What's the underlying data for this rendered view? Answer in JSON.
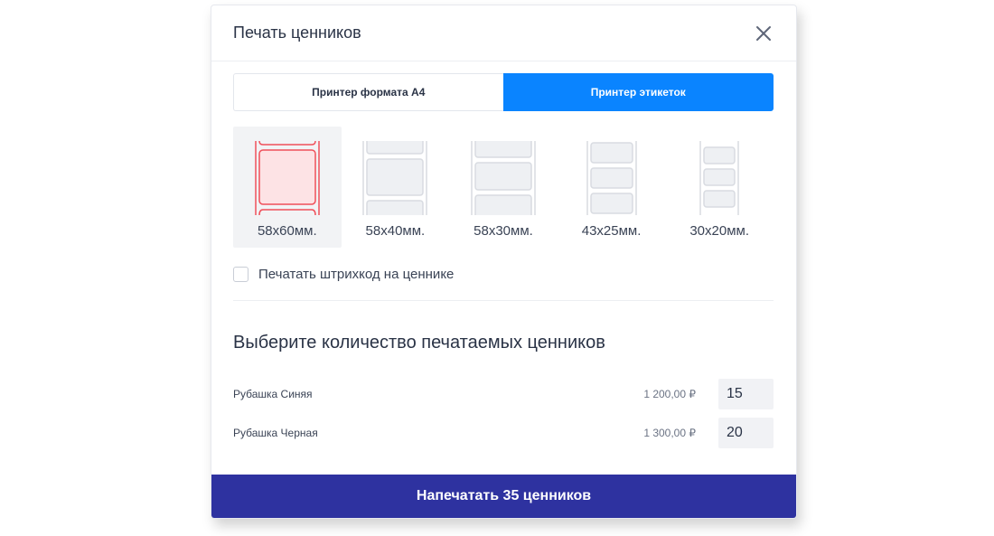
{
  "dialog": {
    "title": "Печать ценников",
    "close_icon": "close-icon"
  },
  "tabs": [
    {
      "label": "Принтер формата А4",
      "active": false
    },
    {
      "label": "Принтер этикеток",
      "active": true
    }
  ],
  "label_sizes": [
    {
      "label": "58x60мм.",
      "selected": true
    },
    {
      "label": "58x40мм.",
      "selected": false
    },
    {
      "label": "58x30мм.",
      "selected": false
    },
    {
      "label": "43x25мм.",
      "selected": false
    },
    {
      "label": "30x20мм.",
      "selected": false
    }
  ],
  "barcode_option": {
    "label": "Печатать штрихкод на ценнике",
    "checked": false
  },
  "quantity_section": {
    "title": "Выберите количество печатаемых ценников",
    "items": [
      {
        "name": "Рубашка Синяя",
        "price": "1 200,00 ₽",
        "quantity": "15"
      },
      {
        "name": "Рубашка Черная",
        "price": "1 300,00 ₽",
        "quantity": "20"
      }
    ]
  },
  "print_button": {
    "label": "Напечатать 35 ценников"
  },
  "colors": {
    "accent_blue": "#0a84ff",
    "primary_button": "#2e32a0",
    "selected_red": "#f0505a",
    "selected_bg": "#f2f3f5"
  }
}
